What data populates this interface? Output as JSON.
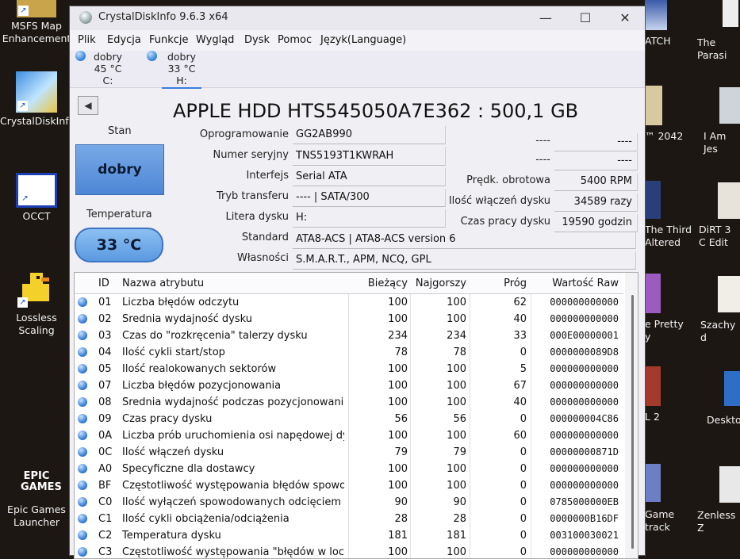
{
  "desktop": {
    "left_icons": [
      {
        "label": "MSFS Map Enhancement"
      },
      {
        "label": "CrystalDiskInfo"
      },
      {
        "label": "OCCT"
      },
      {
        "label": "Lossless Scaling"
      },
      {
        "label": "Epic Games Launcher",
        "logo_text": "EPIC GAMES"
      }
    ],
    "right_icons": [
      {
        "label": "ATCH"
      },
      {
        "label": "The Parasi"
      },
      {
        "label": "™ 2042"
      },
      {
        "label": "I Am Jes"
      },
      {
        "label": "The Third Altered"
      },
      {
        "label": "DiRT 3 C Edit"
      },
      {
        "label": "e Pretty y"
      },
      {
        "label": "Szachy d"
      },
      {
        "label": "L 2"
      },
      {
        "label": "Deskto"
      },
      {
        "label": "Game track"
      },
      {
        "label": "Zenless Z"
      }
    ]
  },
  "window": {
    "title": "CrystalDiskInfo 9.6.3 x64",
    "controls": {
      "minimize": "—",
      "maximize": "☐",
      "close": "✕"
    },
    "menu": [
      "Plik",
      "Edycja",
      "Funkcje",
      "Wygląd",
      "Dysk",
      "Pomoc",
      "Język(Language)"
    ],
    "disk_tabs": [
      {
        "status": "dobry",
        "temp": "45 °C",
        "letter": "C:"
      },
      {
        "status": "dobry",
        "temp": "33 °C",
        "letter": "H:"
      }
    ],
    "back_symbol": "◀",
    "drive_title": "APPLE HDD HTS545050A7E362 : 500,1 GB",
    "health": {
      "label": "Stan",
      "value": "dobry"
    },
    "temperature": {
      "label": "Temperatura",
      "value": "33 °C"
    },
    "info_left": [
      {
        "label": "Oprogramowanie",
        "value": "GG2AB990"
      },
      {
        "label": "Numer seryjny",
        "value": "TNS5193T1KWRAH"
      },
      {
        "label": "Interfejs",
        "value": "Serial ATA"
      },
      {
        "label": "Tryb transferu",
        "value": "---- | SATA/300"
      },
      {
        "label": "Litera dysku",
        "value": "H:"
      }
    ],
    "info_right": [
      {
        "label": "----",
        "value": "----"
      },
      {
        "label": "----",
        "value": "----"
      },
      {
        "label": "Prędk. obrotowa",
        "value": "5400 RPM"
      },
      {
        "label": "Ilość włączeń dysku",
        "value": "34589 razy"
      },
      {
        "label": "Czas pracy dysku",
        "value": "19590 godzin"
      }
    ],
    "info_full": [
      {
        "label": "Standard",
        "value": "ATA8-ACS | ATA8-ACS version 6"
      },
      {
        "label": "Własności",
        "value": "S.M.A.R.T., APM, NCQ, GPL"
      }
    ],
    "smart": {
      "headers": {
        "id": "ID",
        "name": "Nazwa atrybutu",
        "current": "Bieżący",
        "worst": "Najgorszy",
        "threshold": "Próg",
        "raw": "Wartość Raw"
      },
      "rows": [
        {
          "id": "01",
          "name": "Liczba błędów odczytu",
          "current": "100",
          "worst": "100",
          "threshold": "62",
          "raw": "000000000000"
        },
        {
          "id": "02",
          "name": "Średnia wydajność dysku",
          "current": "100",
          "worst": "100",
          "threshold": "40",
          "raw": "000000000000"
        },
        {
          "id": "03",
          "name": "Czas do \"rozkręcenia\" talerzy dysku",
          "current": "234",
          "worst": "234",
          "threshold": "33",
          "raw": "000E00000001"
        },
        {
          "id": "04",
          "name": "Ilość cykli start/stop",
          "current": "78",
          "worst": "78",
          "threshold": "0",
          "raw": "0000000089D8"
        },
        {
          "id": "05",
          "name": "Ilość realokowanych sektorów",
          "current": "100",
          "worst": "100",
          "threshold": "5",
          "raw": "000000000000"
        },
        {
          "id": "07",
          "name": "Liczba błędów pozycjonowania",
          "current": "100",
          "worst": "100",
          "threshold": "67",
          "raw": "000000000000"
        },
        {
          "id": "08",
          "name": "Średnia wydajność podczas pozycjonowania",
          "current": "100",
          "worst": "100",
          "threshold": "40",
          "raw": "000000000000"
        },
        {
          "id": "09",
          "name": "Czas pracy dysku",
          "current": "56",
          "worst": "56",
          "threshold": "0",
          "raw": "000000004C86"
        },
        {
          "id": "0A",
          "name": "Liczba prób uruchomienia osi napędowej dys...",
          "current": "100",
          "worst": "100",
          "threshold": "60",
          "raw": "000000000000"
        },
        {
          "id": "0C",
          "name": "Ilość włączeń dysku",
          "current": "79",
          "worst": "79",
          "threshold": "0",
          "raw": "00000000871D"
        },
        {
          "id": "A0",
          "name": "Specyficzne dla dostawcy",
          "current": "100",
          "worst": "100",
          "threshold": "0",
          "raw": "000000000000"
        },
        {
          "id": "BF",
          "name": "Częstotliwość występowania błędów spowod...",
          "current": "100",
          "worst": "100",
          "threshold": "0",
          "raw": "000000000000"
        },
        {
          "id": "C0",
          "name": "Ilość wyłączeń spowodowanych odcięciem za...",
          "current": "90",
          "worst": "90",
          "threshold": "0",
          "raw": "0785000000EB"
        },
        {
          "id": "C1",
          "name": "Ilość cykli obciążenia/odciążenia",
          "current": "28",
          "worst": "28",
          "threshold": "0",
          "raw": "0000000B16DF"
        },
        {
          "id": "C2",
          "name": "Temperatura dysku",
          "current": "181",
          "worst": "181",
          "threshold": "0",
          "raw": "003100030021"
        },
        {
          "id": "C3",
          "name": "Częstotliwość występowania \"błędów w locie\"",
          "current": "100",
          "worst": "100",
          "threshold": "0",
          "raw": "000000000000"
        }
      ]
    }
  },
  "colors": {
    "accent": "#3b7ddd",
    "health_good": "#5b93dc",
    "window_bg": "#f0eff4",
    "desktop_bg": "#1c1712"
  }
}
